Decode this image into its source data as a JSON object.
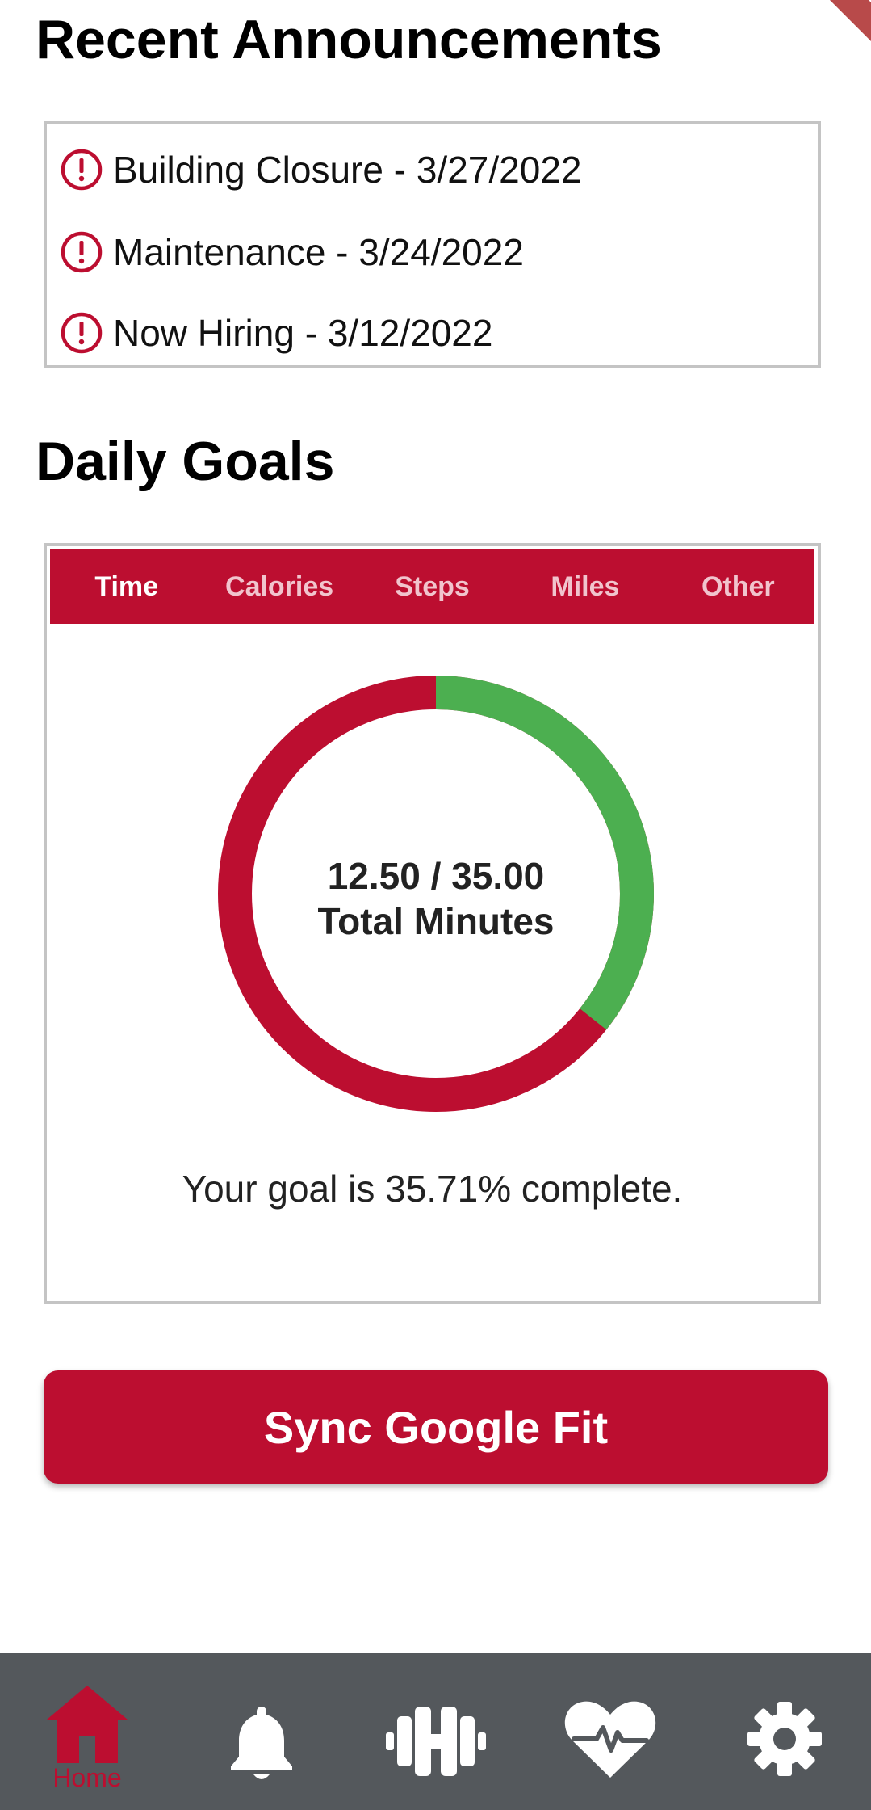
{
  "announcements": {
    "title": "Recent Announcements",
    "items": [
      {
        "text": "Building Closure - 3/27/2022",
        "icon": "alert-circle-icon"
      },
      {
        "text": "Maintenance - 3/24/2022",
        "icon": "alert-circle-icon"
      },
      {
        "text": "Now Hiring - 3/12/2022",
        "icon": "alert-circle-icon"
      }
    ]
  },
  "goals": {
    "title": "Daily Goals",
    "tabs": [
      "Time",
      "Calories",
      "Steps",
      "Miles",
      "Other"
    ],
    "active_tab": "Time",
    "progress": {
      "current": "12.50",
      "target": "35.00",
      "ring_text": "12.50 / 35.00",
      "unit_text": "Total Minutes",
      "fraction": 0.3571
    },
    "complete_text": "Your goal is 35.71% complete."
  },
  "sync_button": {
    "label": "Sync Google Fit"
  },
  "bottom_nav": {
    "items": [
      {
        "icon": "home-icon",
        "label": "Home",
        "active": true
      },
      {
        "icon": "bell-icon",
        "label": "",
        "active": false
      },
      {
        "icon": "dumbbell-icon",
        "label": "",
        "active": false
      },
      {
        "icon": "heart-pulse-icon",
        "label": "",
        "active": false
      },
      {
        "icon": "gear-icon",
        "label": "",
        "active": false
      }
    ]
  },
  "colors": {
    "brand": "#bc0e30",
    "progress": "#4caf50",
    "nav_bg": "#54585c"
  }
}
